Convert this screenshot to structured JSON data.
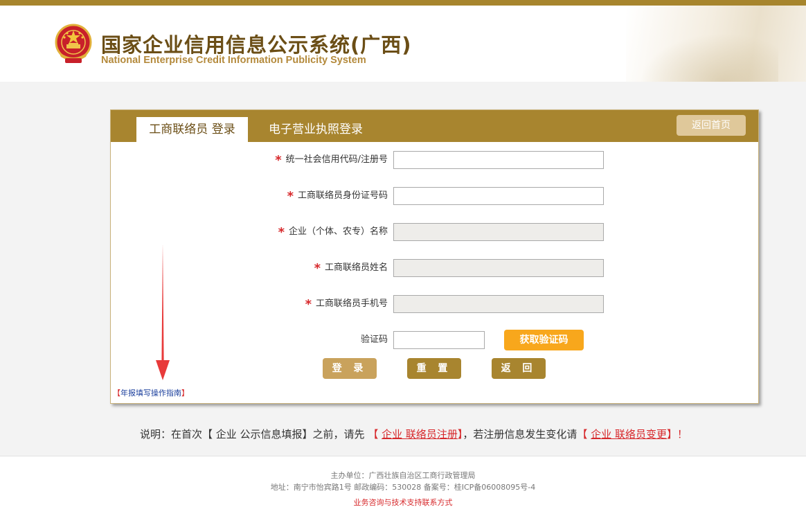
{
  "header": {
    "title_cn": "国家企业信用信息公示系统(广西)",
    "title_en": "National Enterprise Credit Information Publicity System"
  },
  "tabs": {
    "active": "工商联络员 登录",
    "inactive": "电子营业执照登录"
  },
  "back_home": "返回首页",
  "form": {
    "fields": [
      {
        "label": "统一社会信用代码/注册号",
        "required": true,
        "disabled": false,
        "value": ""
      },
      {
        "label": "工商联络员身份证号码",
        "required": true,
        "disabled": false,
        "value": ""
      },
      {
        "label": "企业（个体、农专）名称",
        "required": true,
        "disabled": true,
        "value": ""
      },
      {
        "label": "工商联络员姓名",
        "required": true,
        "disabled": true,
        "value": ""
      },
      {
        "label": "工商联络员手机号",
        "required": true,
        "disabled": true,
        "value": ""
      }
    ],
    "required_mark": "*",
    "captcha_label": "验证码",
    "captcha_button": "获取验证码"
  },
  "buttons": {
    "login": "登 录",
    "reset": "重 置",
    "back": "返 回"
  },
  "guide": {
    "open": "【",
    "text": "年报填写操作指南",
    "close": "】"
  },
  "note": {
    "prefix": "说明：在首次【 企业 公示信息填报】之前，请先 ",
    "link1_open": "【 ",
    "link1": "企业 联络员注册",
    "link1_close": "】",
    "middle": "，若注册信息发生变化请",
    "link2_open": "【 ",
    "link2": "企业 联络员变更",
    "link2_close": "】！"
  },
  "footer": {
    "sponsor": "主办单位：广西壮族自治区工商行政管理局",
    "address": "地址：南宁市怡宾路1号 邮政编码：530028    备案号：桂ICP备06008095号-4",
    "contact": "业务咨询与技术支持联系方式"
  },
  "colors": {
    "brand": "#a8852f",
    "accent_orange": "#f8a71c",
    "required_red": "#d7282b",
    "guide_blue": "#1a3e9c"
  },
  "icons": {
    "emblem": "national-emblem-icon",
    "arrow": "red-down-arrow-icon"
  }
}
